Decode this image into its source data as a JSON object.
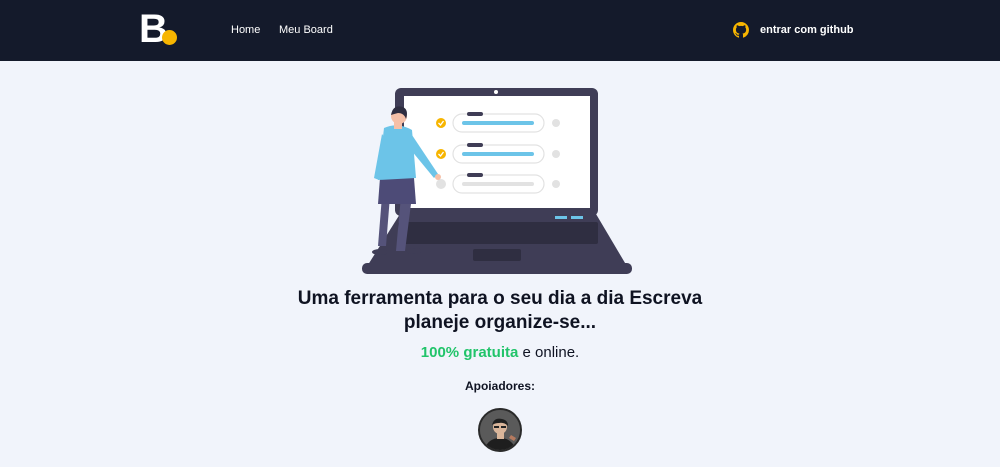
{
  "colors": {
    "header_bg": "#141a2b",
    "page_bg": "#f1f4fb",
    "brand_yellow": "#f7b500",
    "accent_green": "#21c46a"
  },
  "header": {
    "logo_text": "B",
    "nav": {
      "home_label": "Home",
      "board_label": "Meu Board"
    },
    "login": {
      "icon": "github-icon",
      "label": "entrar com github"
    }
  },
  "hero": {
    "illustration": "person-at-laptop-checklist-illustration",
    "headline_line1": "Uma ferramenta para o seu dia a dia Escreva",
    "headline_line2": "planeje organize-se...",
    "subline_accent": "100% gratuita",
    "subline_rest": " e online.",
    "supporters_label": "Apoiadores:",
    "supporter_avatar": "supporter-avatar"
  }
}
